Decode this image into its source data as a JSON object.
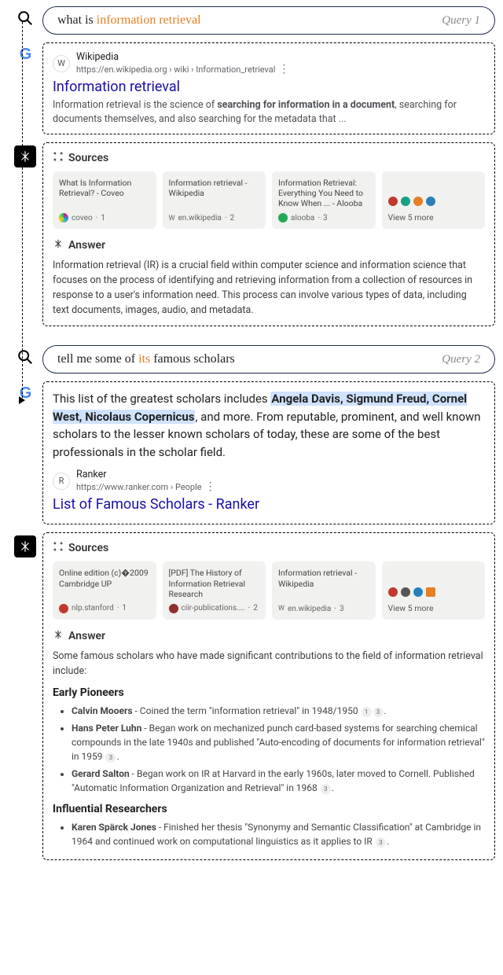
{
  "query1": {
    "label": "Query 1",
    "prefix": "what is ",
    "highlight": "information retrieval"
  },
  "google1": {
    "site": "Wikipedia",
    "url": "https://en.wikipedia.org › wiki › Information_retrieval",
    "favicon": "W",
    "title": "Information retrieval",
    "snippet_pre": "Information retrieval is the science of ",
    "snippet_bold": "searching for information in a document",
    "snippet_post": ", searching for documents themselves, and also searching for the metadata that ..."
  },
  "perp1": {
    "sources_label": "Sources",
    "answer_label": "Answer",
    "sources": [
      {
        "title": "What Is Information Retrieval? - Coveo",
        "domain": "coveo",
        "num": "1"
      },
      {
        "title": "Information retrieval - Wikipedia",
        "domain": "en.wikipedia",
        "num": "2"
      },
      {
        "title": "Information Retrieval: Everything You Need to Know When ... - Alooba",
        "domain": "alooba",
        "num": "3"
      }
    ],
    "more": "View 5 more",
    "answer": "Information retrieval (IR) is a crucial field within computer science and information science that focuses on the process of identifying and retrieving information from a collection of resources in response to a user's information need. This process can involve various types of data, including text documents, images, audio, and metadata."
  },
  "query2": {
    "label": "Query 2",
    "pre": "tell me some of ",
    "highlight": "its",
    "post": " famous scholars"
  },
  "google2": {
    "featured_pre": "This list of the greatest scholars includes ",
    "featured_hl": "Angela Davis, Sigmund Freud, Cornel West, Nicolaus Copernicus",
    "featured_post": ", and more. From reputable, prominent, and well known scholars to the lesser known scholars of today, these are some of the best professionals in the scholar field.",
    "site": "Ranker",
    "url": "https://www.ranker.com › People",
    "favicon": "R",
    "title": "List of Famous Scholars - Ranker"
  },
  "perp2": {
    "sources_label": "Sources",
    "answer_label": "Answer",
    "sources": [
      {
        "title": "Online edition (c)�2009 Cambridge UP",
        "domain": "nlp.stanford",
        "num": "1"
      },
      {
        "title": "[PDF] The History of Information Retrieval Research",
        "domain": "ciir-publications....",
        "num": "2"
      },
      {
        "title": "Information retrieval - Wikipedia",
        "domain": "en.wikipedia",
        "num": "3"
      }
    ],
    "more": "View 5 more",
    "intro": "Some famous scholars who have made significant contributions to the field of information retrieval include:",
    "h1": "Early Pioneers",
    "pioneers": [
      {
        "name": "Calvin Mooers",
        "desc": " - Coined the term \"information retrieval\" in 1948/1950",
        "cites": [
          "1",
          "3"
        ]
      },
      {
        "name": "Hans Peter Luhn",
        "desc": " - Began work on mechanized punch card-based systems for searching chemical compounds in the late 1940s and published \"Auto-encoding of documents for information retrieval\" in 1959",
        "cites": [
          "3"
        ]
      },
      {
        "name": "Gerard Salton",
        "desc": " - Began work on IR at Harvard in the early 1960s, later moved to Cornell. Published \"Automatic Information Organization and Retrieval\" in 1968",
        "cites": [
          "3"
        ]
      }
    ],
    "h2": "Influential Researchers",
    "influential": [
      {
        "name": "Karen Spärck Jones",
        "desc": " - Finished her thesis \"Synonymy and Semantic Classification\" at Cambridge in 1964 and continued work on computational linguistics as it applies to IR",
        "cites": [
          "3"
        ]
      }
    ]
  }
}
